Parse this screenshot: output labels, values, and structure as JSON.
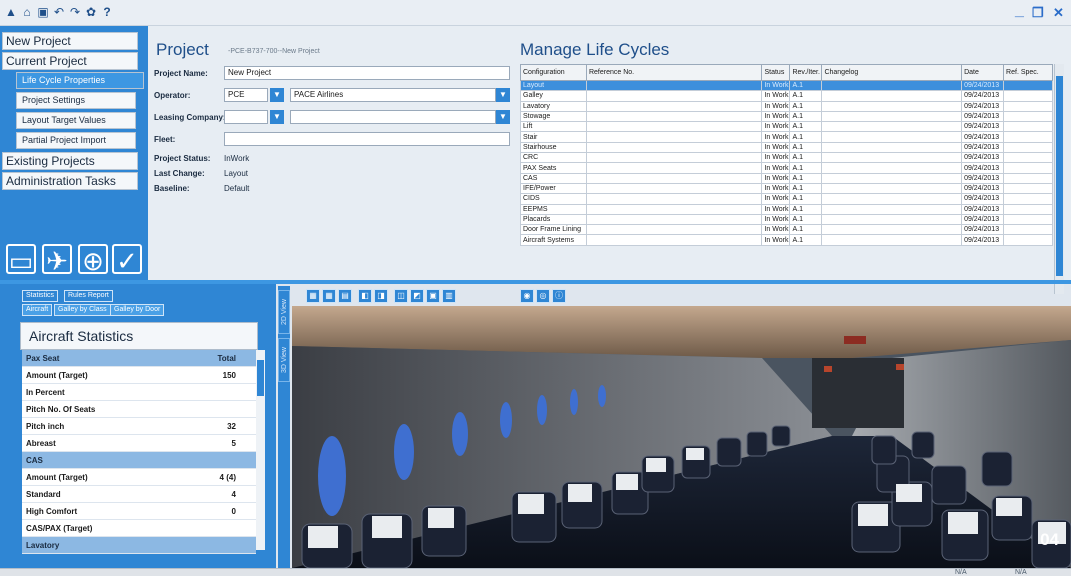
{
  "toolbar_icons": [
    "upload-icon",
    "home-icon",
    "save-icon",
    "undo-icon",
    "redo-icon",
    "settings-icon",
    "help-icon"
  ],
  "toolbar_glyphs": [
    "▲",
    "⌂",
    "▣",
    "↶",
    "↷",
    "✿",
    "?"
  ],
  "window": {
    "minimize": "_",
    "restore": "❐",
    "close": "✕"
  },
  "nav": {
    "new_project": "New Project",
    "current_project": "Current Project",
    "sub_items": [
      "Life Cycle Properties",
      "Project Settings",
      "Layout Target Values",
      "Partial Project Import"
    ],
    "existing_projects": "Existing Projects",
    "admin_tasks": "Administration Tasks",
    "big_icons": [
      "folder-icon",
      "airplane-icon",
      "globe-icon",
      "clipboard-icon"
    ],
    "big_glyphs": [
      "▭",
      "✈",
      "⊕",
      "✓"
    ]
  },
  "project": {
    "title": "Project",
    "crumb": "-PCE-B737-700--New Project",
    "name_label": "Project Name:",
    "name_value": "New Project",
    "operator_label": "Operator:",
    "operator_code": "PCE",
    "operator_name": "PACE Airlines",
    "leasing_label": "Leasing Company:",
    "fleet_label": "Fleet:",
    "status_label": "Project Status:",
    "status_value": "InWork",
    "last_change_label": "Last Change:",
    "last_change_value": "Layout",
    "baseline_label": "Baseline:",
    "baseline_value": "Default",
    "dd_arrow": "▼"
  },
  "lifecycles": {
    "title": "Manage Life Cycles",
    "columns": [
      "Configuration",
      "Reference No.",
      "Status",
      "Rev./Iter.",
      "Changelog",
      "Date",
      "Ref. Spec."
    ],
    "rows": [
      [
        "Layout",
        "",
        "In Work",
        "A.1",
        "",
        "09/24/2013",
        ""
      ],
      [
        "Galley",
        "",
        "In Work",
        "A.1",
        "",
        "09/24/2013",
        ""
      ],
      [
        "Lavatory",
        "",
        "In Work",
        "A.1",
        "",
        "09/24/2013",
        ""
      ],
      [
        "Stowage",
        "",
        "In Work",
        "A.1",
        "",
        "09/24/2013",
        ""
      ],
      [
        "Lift",
        "",
        "In Work",
        "A.1",
        "",
        "09/24/2013",
        ""
      ],
      [
        "Stair",
        "",
        "In Work",
        "A.1",
        "",
        "09/24/2013",
        ""
      ],
      [
        "Stairhouse",
        "",
        "In Work",
        "A.1",
        "",
        "09/24/2013",
        ""
      ],
      [
        "CRC",
        "",
        "In Work",
        "A.1",
        "",
        "09/24/2013",
        ""
      ],
      [
        "PAX Seats",
        "",
        "In Work",
        "A.1",
        "",
        "09/24/2013",
        ""
      ],
      [
        "CAS",
        "",
        "In Work",
        "A.1",
        "",
        "09/24/2013",
        ""
      ],
      [
        "IFE/Power",
        "",
        "In Work",
        "A.1",
        "",
        "09/24/2013",
        ""
      ],
      [
        "CIDS",
        "",
        "In Work",
        "A.1",
        "",
        "09/24/2013",
        ""
      ],
      [
        "EEPMS",
        "",
        "In Work",
        "A.1",
        "",
        "09/24/2013",
        ""
      ],
      [
        "Placards",
        "",
        "In Work",
        "A.1",
        "",
        "09/24/2013",
        ""
      ],
      [
        "Door Frame Lining",
        "",
        "In Work",
        "A.1",
        "",
        "09/24/2013",
        ""
      ],
      [
        "Aircraft Systems",
        "",
        "In Work",
        "A.1",
        "",
        "09/24/2013",
        ""
      ]
    ]
  },
  "stats": {
    "tab_statistics": "Statistics",
    "tab_rules": "Rules Report",
    "sub_aircraft": "Aircraft",
    "sub_galley_class": "Galley by Class",
    "sub_galley_door": "Galley by Door",
    "title": "Aircraft Statistics",
    "rows": [
      {
        "k": "Pax Seat",
        "v": "Total",
        "section": true
      },
      {
        "k": "Amount (Target)",
        "v": "150",
        "section": false
      },
      {
        "k": "In Percent",
        "v": "",
        "section": false
      },
      {
        "k": "Pitch No. Of Seats",
        "v": "",
        "section": false
      },
      {
        "k": "Pitch inch",
        "v": "32",
        "section": false
      },
      {
        "k": "Abreast",
        "v": "5",
        "section": false
      },
      {
        "k": "CAS",
        "v": "",
        "section": true
      },
      {
        "k": "Amount (Target)",
        "v": "4 (4)",
        "section": false
      },
      {
        "k": "Standard",
        "v": "4",
        "section": false
      },
      {
        "k": "High Comfort",
        "v": "0",
        "section": false
      },
      {
        "k": "CAS/PAX (Target)",
        "v": "",
        "section": false
      },
      {
        "k": "Lavatory",
        "v": "",
        "section": true
      }
    ]
  },
  "view_tabs": [
    "2D View",
    "3D View"
  ],
  "badge": "04",
  "status_na": [
    "N/A",
    "N/A"
  ],
  "colors": {
    "accent": "#2f86d4",
    "selection": "#3d8fdc",
    "title_blue": "#1f4f8a"
  }
}
